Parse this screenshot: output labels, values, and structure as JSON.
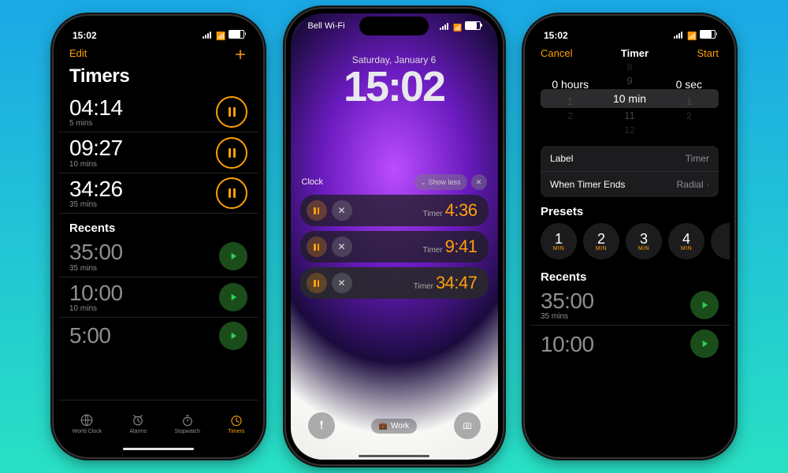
{
  "phone1": {
    "status_time": "15:02",
    "nav": {
      "edit": "Edit"
    },
    "title": "Timers",
    "active": [
      {
        "time": "04:14",
        "sub": "5 mins"
      },
      {
        "time": "09:27",
        "sub": "10 mins"
      },
      {
        "time": "34:26",
        "sub": "35 mins"
      }
    ],
    "recents_header": "Recents",
    "recents": [
      {
        "time": "35:00",
        "sub": "35 mins"
      },
      {
        "time": "10:00",
        "sub": "10 mins"
      },
      {
        "time": "5:00",
        "sub": ""
      }
    ],
    "tabs": [
      {
        "label": "World Clock"
      },
      {
        "label": "Alarms"
      },
      {
        "label": "Stopwatch"
      },
      {
        "label": "Timers"
      }
    ]
  },
  "phone2": {
    "carrier": "Bell Wi-Fi",
    "date": "Saturday, January 6",
    "time": "15:02",
    "live_app": "Clock",
    "show_less": "Show less",
    "timers": [
      {
        "label": "Timer",
        "value": "4:36"
      },
      {
        "label": "Timer",
        "value": "9:41"
      },
      {
        "label": "Timer",
        "value": "34:47"
      }
    ],
    "focus": "Work"
  },
  "phone3": {
    "status_time": "15:02",
    "nav": {
      "cancel": "Cancel",
      "title": "Timer",
      "start": "Start"
    },
    "picker": {
      "hours_above2": "",
      "hours_above": "",
      "hours": "0 hours",
      "hours_below": "1",
      "hours_below2": "2",
      "min_above2": "8",
      "min_above": "9",
      "min": "10 min",
      "min_below": "11",
      "min_below2": "12",
      "sec_above2": "",
      "sec_above": "",
      "sec": "0 sec",
      "sec_below": "1",
      "sec_below2": "2"
    },
    "config": {
      "label_key": "Label",
      "label_val": "Timer",
      "ends_key": "When Timer Ends",
      "ends_val": "Radial"
    },
    "presets_header": "Presets",
    "presets": [
      {
        "n": "1",
        "u": "MIN"
      },
      {
        "n": "2",
        "u": "MIN"
      },
      {
        "n": "3",
        "u": "MIN"
      },
      {
        "n": "4",
        "u": "MIN"
      }
    ],
    "recents_header": "Recents",
    "recents": [
      {
        "time": "35:00",
        "sub": "35 mins"
      },
      {
        "time": "10:00",
        "sub": ""
      }
    ]
  }
}
